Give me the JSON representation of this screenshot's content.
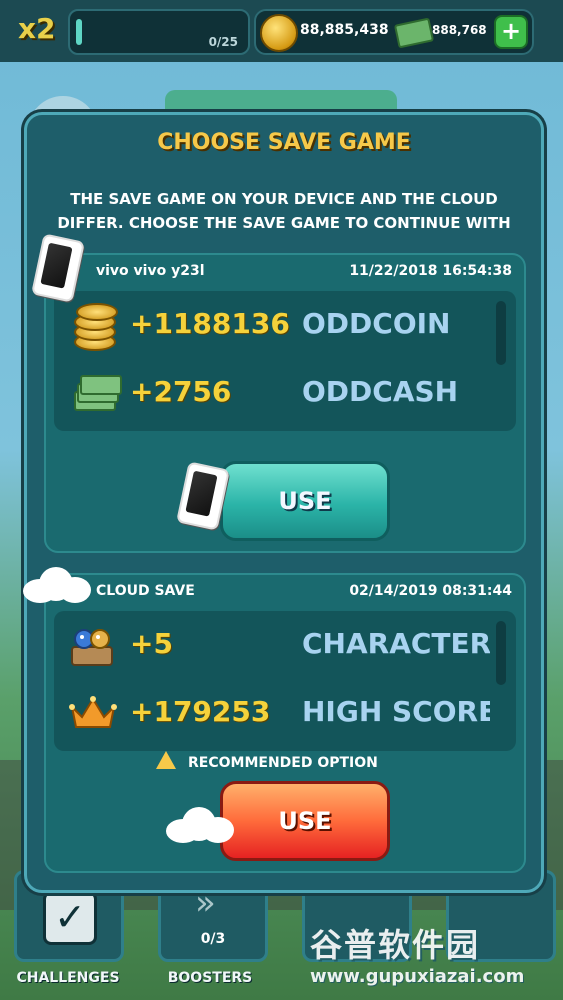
{
  "hud": {
    "multiplier": "x2",
    "mission_progress": "0/25",
    "coins": "88,885,438",
    "cash": "888,768",
    "add_label": "+"
  },
  "dialog": {
    "title": "CHOOSE SAVE GAME",
    "message": "THE SAVE GAME ON YOUR DEVICE AND THE CLOUD DIFFER. CHOOSE THE SAVE GAME TO CONTINUE WITH",
    "device": {
      "name": "vivo vivo y23l",
      "date": "11/22/2018 16:54:38",
      "rows": [
        {
          "amount": "+1188136",
          "label": "ODDCOIN",
          "icon": "coins-icon"
        },
        {
          "amount": "+2756",
          "label": "ODDCASH",
          "icon": "cash-icon"
        }
      ],
      "button": "USE"
    },
    "cloud": {
      "name": "CLOUD SAVE",
      "date": "02/14/2019 08:31:44",
      "rows": [
        {
          "amount": "+5",
          "label": "CHARACTERS",
          "icon": "characters-icon"
        },
        {
          "amount": "+179253",
          "label": "HIGH SCORE",
          "icon": "crown-icon"
        }
      ],
      "recommended": "RECOMMENDED OPTION",
      "button": "USE"
    }
  },
  "bottom_nav": {
    "challenges": "CHALLENGES",
    "boosters": "BOOSTERS",
    "boosters_count": "0/3"
  },
  "watermark": {
    "line1": "谷普软件园",
    "line2": "www.gupuxiazai.com"
  },
  "colors": {
    "title": "#f6c94a",
    "amount": "#f5d23b",
    "resource_label": "#a8d3f0",
    "dialog_bg": "#1e5e6a"
  }
}
